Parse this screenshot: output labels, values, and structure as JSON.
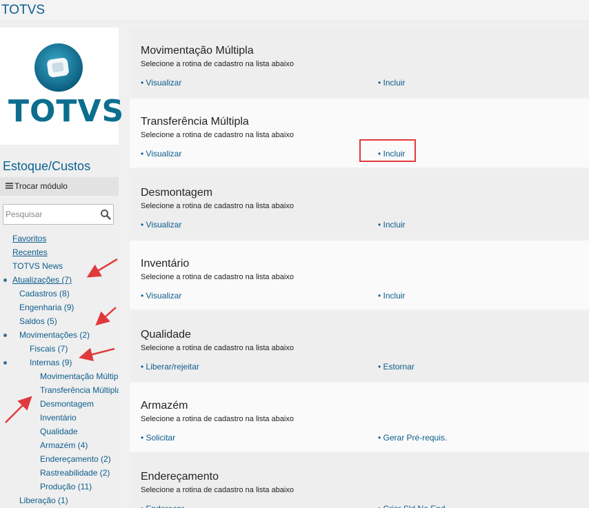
{
  "app": {
    "title": "TOTVS",
    "logo_text": "TOTVS"
  },
  "sidebar": {
    "module_title": "Estoque/Custos",
    "change_module": "Trocar módulo",
    "search_placeholder": "Pesquisar",
    "items": [
      {
        "label": "Favoritos",
        "level": 0,
        "bullet": false,
        "underline": true
      },
      {
        "label": "Recentes",
        "level": 0,
        "bullet": false,
        "underline": true
      },
      {
        "label": "TOTVS News",
        "level": 0,
        "bullet": false,
        "underline": false
      },
      {
        "label": "Atualizações (7)",
        "level": 0,
        "bullet": true,
        "underline": true
      },
      {
        "label": "Cadastros (8)",
        "level": 1,
        "bullet": false,
        "underline": false
      },
      {
        "label": "Engenharia (9)",
        "level": 1,
        "bullet": false,
        "underline": false
      },
      {
        "label": "Saldos (5)",
        "level": 1,
        "bullet": false,
        "underline": false
      },
      {
        "label": "Movimentações (2)",
        "level": 1,
        "bullet": true,
        "underline": false
      },
      {
        "label": "Fiscais (7)",
        "level": 2,
        "bullet": false,
        "underline": false
      },
      {
        "label": "Internas (9)",
        "level": 2,
        "bullet": true,
        "underline": false
      },
      {
        "label": "Movimentação Múltipla",
        "level": 3,
        "bullet": false,
        "underline": false
      },
      {
        "label": "Transferência Múltipla",
        "level": 3,
        "bullet": false,
        "underline": false
      },
      {
        "label": "Desmontagem",
        "level": 3,
        "bullet": false,
        "underline": false
      },
      {
        "label": "Inventário",
        "level": 3,
        "bullet": false,
        "underline": false
      },
      {
        "label": "Qualidade",
        "level": 3,
        "bullet": false,
        "underline": false
      },
      {
        "label": "Armazém (4)",
        "level": 3,
        "bullet": false,
        "underline": false
      },
      {
        "label": "Endereçamento (2)",
        "level": 3,
        "bullet": false,
        "underline": false
      },
      {
        "label": "Rastreabilidade (2)",
        "level": 3,
        "bullet": false,
        "underline": false
      },
      {
        "label": "Produção (11)",
        "level": 3,
        "bullet": false,
        "underline": false
      },
      {
        "label": "Liberação (1)",
        "level": 1,
        "bullet": false,
        "underline": false
      }
    ]
  },
  "panels": [
    {
      "title": "Movimentação Múltipla",
      "subtitle": "Selecione a rotina de cadastro na lista abaixo",
      "left_link": "• Visualizar",
      "right_link": "• Incluir",
      "highlighted": false
    },
    {
      "title": "Transferência Múltipla",
      "subtitle": "Selecione a rotina de cadastro na lista abaixo",
      "left_link": "• Visualizar",
      "right_link": "• Incluir",
      "highlighted": true
    },
    {
      "title": "Desmontagem",
      "subtitle": "Selecione a rotina de cadastro na lista abaixo",
      "left_link": "• Visualizar",
      "right_link": "• Incluir",
      "highlighted": false
    },
    {
      "title": "Inventário",
      "subtitle": "Selecione a rotina de cadastro na lista abaixo",
      "left_link": "• Visualizar",
      "right_link": "• Incluir",
      "highlighted": false
    },
    {
      "title": "Qualidade",
      "subtitle": "Selecione a rotina de cadastro na lista abaixo",
      "left_link": "• Liberar/rejeitar",
      "right_link": "• Estornar",
      "highlighted": false
    },
    {
      "title": "Armazém",
      "subtitle": "Selecione a rotina de cadastro na lista abaixo",
      "left_link": "• Solicitar",
      "right_link": "• Gerar Pré-requis.",
      "highlighted": false
    },
    {
      "title": "Endereçamento",
      "subtitle": "Selecione a rotina de cadastro na lista abaixo",
      "left_link": "• Enderecar",
      "right_link": "• Criar Sld No End",
      "highlighted": false
    }
  ],
  "colors": {
    "link": "#0b5c8c",
    "brand": "#0c6e8e",
    "annotation": "#e0393b"
  },
  "icons": {
    "logo": "totvs-logo-icon",
    "menu": "hamburger-icon",
    "search": "magnifier-icon"
  }
}
